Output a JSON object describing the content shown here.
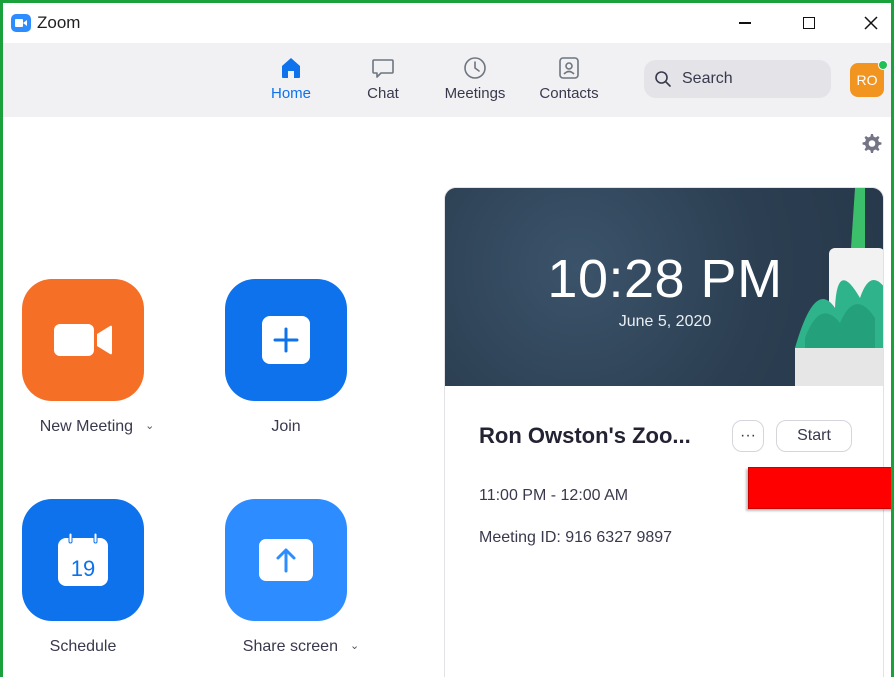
{
  "window": {
    "title": "Zoom",
    "controls": [
      "minimize-icon",
      "maximize-icon",
      "close-icon"
    ]
  },
  "nav": {
    "tabs": [
      {
        "label": "Home",
        "icon": "home-icon",
        "active": true
      },
      {
        "label": "Chat",
        "icon": "chat-bubble-icon",
        "active": false
      },
      {
        "label": "Meetings",
        "icon": "clock-icon",
        "active": false
      },
      {
        "label": "Contacts",
        "icon": "contacts-icon",
        "active": false
      }
    ],
    "search_label": "Search",
    "avatar_initials": "RO",
    "avatar_color": "#f19420",
    "status_color": "#20c055"
  },
  "actions": {
    "new_meeting": {
      "label": "New Meeting",
      "color": "#f56f27",
      "icon": "video-camera-icon"
    },
    "join": {
      "label": "Join",
      "color": "#0e72ed",
      "icon": "plus-icon"
    },
    "schedule": {
      "label": "Schedule",
      "color": "#0e72ed",
      "icon": "calendar-icon",
      "calendar_day": "19"
    },
    "share_screen": {
      "label": "Share screen",
      "color": "#2d8cff",
      "icon": "upload-arrow-icon"
    }
  },
  "card": {
    "time": "10:28 PM",
    "date": "June 5, 2020",
    "meeting_title": "Ron Owston's Zoo...",
    "more_label": "···",
    "start_label": "Start",
    "meeting_time": "11:00 PM - 12:00 AM",
    "meeting_id": "Meeting ID: 916 6327 9897"
  },
  "accent_color": "#0e72ed",
  "frame_color": "#1aa13b",
  "highlight_box_color": "#ff0000"
}
